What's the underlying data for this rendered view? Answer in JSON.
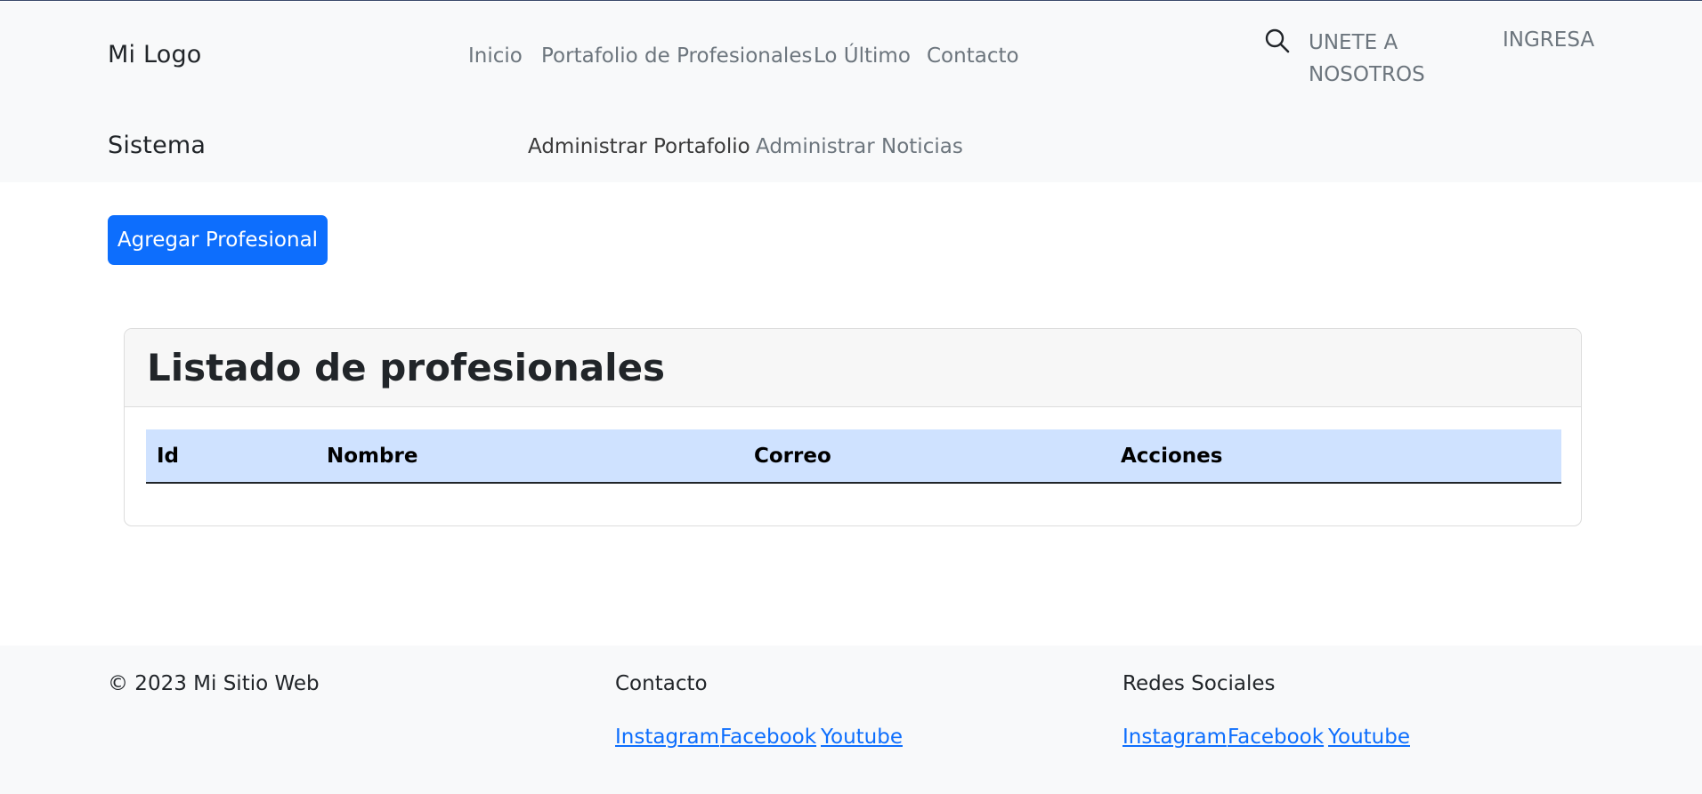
{
  "header": {
    "brand": "Mi Logo",
    "nav": [
      "Inicio",
      "Portafolio de Profesionales",
      "Lo Último",
      "Contacto"
    ],
    "join_line1": "UNETE A",
    "join_line2": "NOSOTROS",
    "login": "INGRESA",
    "icons": {
      "search": "search-icon"
    }
  },
  "admin_nav": {
    "brand": "Sistema",
    "links": [
      "Administrar Portafolio",
      "Administrar Noticias"
    ]
  },
  "main": {
    "add_button": "Agregar Profesional",
    "card_title": "Listado de profesionales",
    "columns": [
      "Id",
      "Nombre",
      "Correo",
      "Acciones"
    ],
    "rows": []
  },
  "footer": {
    "copyright": "© 2023 Mi Sitio Web",
    "contact_title": "Contacto",
    "social_title": "Redes Sociales",
    "contact_links": [
      "Instagram",
      "Facebook",
      "Youtube"
    ],
    "social_links": [
      "Instagram",
      "Facebook",
      "Youtube"
    ]
  },
  "colors": {
    "primary": "#0d6efd",
    "table_header": "#cfe2ff",
    "nav_background": "#f8f9fa"
  }
}
